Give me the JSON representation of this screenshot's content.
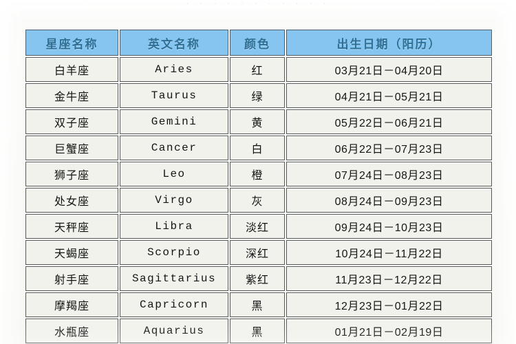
{
  "page": {
    "top_clipped_text": "· · · · ·     · ·     · · · ·",
    "header_bg": "#86c5ef",
    "header_text_color": "#2f6f96",
    "cell_bg": "#f2f2ed",
    "border_color": "#55595a",
    "page_bg": "#f7f7f3"
  },
  "table": {
    "columns": [
      {
        "key": "name",
        "label": "星座名称"
      },
      {
        "key": "en",
        "label": "英文名称"
      },
      {
        "key": "color",
        "label": "颜色"
      },
      {
        "key": "date",
        "label": "出生日期（阳历）"
      }
    ],
    "rows": [
      {
        "name": "白羊座",
        "en": "Aries",
        "color": "红",
        "date": "03月21日－04月20日"
      },
      {
        "name": "金牛座",
        "en": "Taurus",
        "color": "绿",
        "date": "04月21日－05月21日"
      },
      {
        "name": "双子座",
        "en": "Gemini",
        "color": "黄",
        "date": "05月22日－06月21日"
      },
      {
        "name": "巨蟹座",
        "en": "Cancer",
        "color": "白",
        "date": "06月22日－07月23日"
      },
      {
        "name": "狮子座",
        "en": "Leo",
        "color": "橙",
        "date": "07月24日－08月23日"
      },
      {
        "name": "处女座",
        "en": "Virgo",
        "color": "灰",
        "date": "08月24日－09月23日"
      },
      {
        "name": "天秤座",
        "en": "Libra",
        "color": "淡红",
        "date": "09月24日－10月23日"
      },
      {
        "name": "天蝎座",
        "en": "Scorpio",
        "color": "深红",
        "date": "10月24日－11月22日"
      },
      {
        "name": "射手座",
        "en": "Sagittarius",
        "color": "紫红",
        "date": "11月23日－12月22日"
      },
      {
        "name": "摩羯座",
        "en": "Capricorn",
        "color": "黑",
        "date": "12月23日－01月22日"
      },
      {
        "name": "水瓶座",
        "en": "Aquarius",
        "color": "黑",
        "date": "01月21日－02月19日"
      }
    ]
  }
}
